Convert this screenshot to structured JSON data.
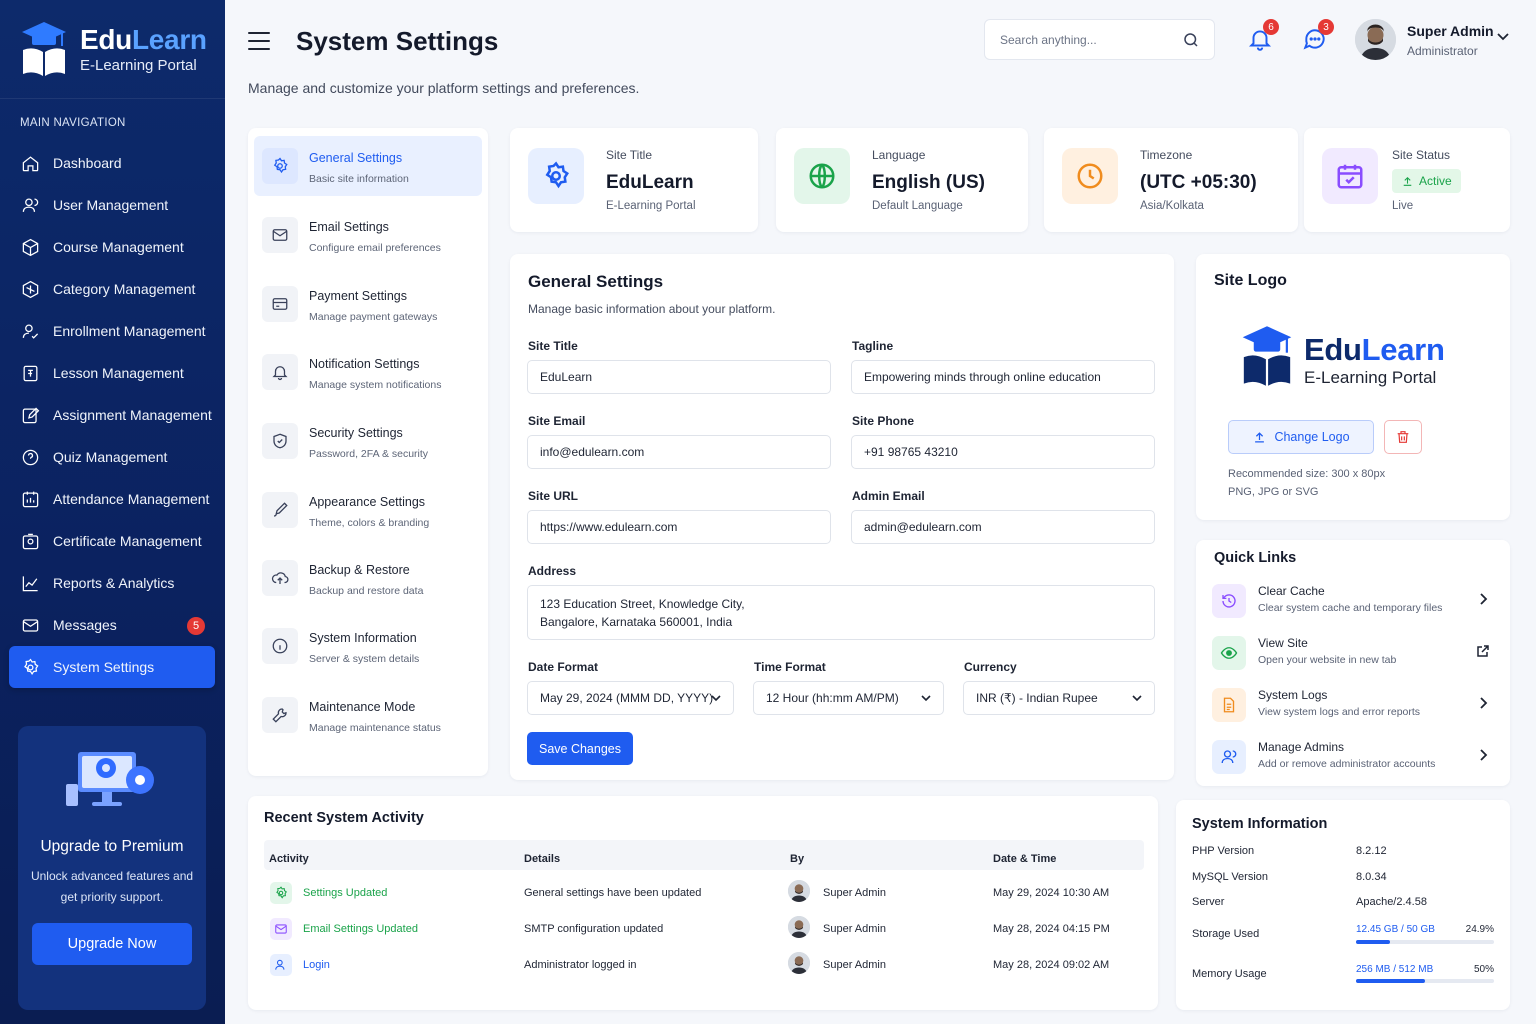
{
  "brand": {
    "name_a": "Edu",
    "name_b": "Learn",
    "subtitle": "E-Learning Portal"
  },
  "sidebar": {
    "heading": "MAIN NAVIGATION",
    "items": [
      {
        "label": "Dashboard",
        "icon": "home-icon"
      },
      {
        "label": "User Management",
        "icon": "users-icon"
      },
      {
        "label": "Course Management",
        "icon": "cube-icon"
      },
      {
        "label": "Category Management",
        "icon": "category-icon"
      },
      {
        "label": "Enrollment Management",
        "icon": "enroll-icon"
      },
      {
        "label": "Lesson Management",
        "icon": "lesson-icon"
      },
      {
        "label": "Assignment Management",
        "icon": "edit-icon"
      },
      {
        "label": "Quiz Management",
        "icon": "quiz-icon"
      },
      {
        "label": "Attendance Management",
        "icon": "attendance-icon"
      },
      {
        "label": "Certificate Management",
        "icon": "certificate-icon"
      },
      {
        "label": "Reports & Analytics",
        "icon": "chart-icon"
      },
      {
        "label": "Messages",
        "icon": "mail-icon",
        "badge": "5"
      },
      {
        "label": "System Settings",
        "icon": "gear-icon",
        "active": true
      }
    ],
    "promo": {
      "title": "Upgrade to Premium",
      "desc": "Unlock advanced features and get priority support.",
      "button": "Upgrade Now"
    }
  },
  "header": {
    "title": "System Settings",
    "subtitle": "Manage and customize your platform settings and preferences.",
    "search_placeholder": "Search anything...",
    "notif_count": "6",
    "msg_count": "3",
    "user_name": "Super Admin",
    "user_role": "Administrator"
  },
  "settings_nav": [
    {
      "title": "General Settings",
      "desc": "Basic site information",
      "active": true
    },
    {
      "title": "Email Settings",
      "desc": "Configure email preferences"
    },
    {
      "title": "Payment Settings",
      "desc": "Manage payment gateways"
    },
    {
      "title": "Notification Settings",
      "desc": "Manage system notifications"
    },
    {
      "title": "Security Settings",
      "desc": "Password, 2FA & security"
    },
    {
      "title": "Appearance Settings",
      "desc": "Theme, colors & branding"
    },
    {
      "title": "Backup & Restore",
      "desc": "Backup and restore data"
    },
    {
      "title": "System Information",
      "desc": "Server & system details"
    },
    {
      "title": "Maintenance Mode",
      "desc": "Manage maintenance status"
    }
  ],
  "stats": [
    {
      "label": "Site Title",
      "value": "EduLearn",
      "sub": "E-Learning Portal"
    },
    {
      "label": "Language",
      "value": "English (US)",
      "sub": "Default Language"
    },
    {
      "label": "Timezone",
      "value": "(UTC +05:30)",
      "sub": "Asia/Kolkata"
    },
    {
      "label": "Site Status",
      "value": "Active",
      "sub": "Live"
    }
  ],
  "general": {
    "title": "General Settings",
    "desc": "Manage basic information about your platform.",
    "site_title_label": "Site Title",
    "site_title": "EduLearn",
    "tagline_label": "Tagline",
    "tagline": "Empowering minds through online education",
    "email_label": "Site Email",
    "email": "info@edulearn.com",
    "phone_label": "Site Phone",
    "phone": "+91 98765 43210",
    "url_label": "Site URL",
    "url": "https://www.edulearn.com",
    "admin_email_label": "Admin Email",
    "admin_email": "admin@edulearn.com",
    "address_label": "Address",
    "address_line1": "123 Education Street, Knowledge City,",
    "address_line2": "Bangalore, Karnataka 560001, India",
    "date_label": "Date Format",
    "date": "May 29, 2024 (MMM DD, YYYY)",
    "time_label": "Time Format",
    "time": "12 Hour (hh:mm AM/PM)",
    "currency_label": "Currency",
    "currency": "INR (₹) - Indian Rupee",
    "save": "Save Changes"
  },
  "logo": {
    "title": "Site Logo",
    "name_a": "Edu",
    "name_b": "Learn",
    "sub": "E-Learning Portal",
    "change": "Change Logo",
    "rec1": "Recommended size: 300 x 80px",
    "rec2": "PNG, JPG or SVG"
  },
  "quick_links": {
    "title": "Quick Links",
    "items": [
      {
        "title": "Clear Cache",
        "desc": "Clear system cache and temporary files"
      },
      {
        "title": "View Site",
        "desc": "Open your website in new tab"
      },
      {
        "title": "System Logs",
        "desc": "View system logs and error reports"
      },
      {
        "title": "Manage Admins",
        "desc": "Add or remove administrator accounts"
      }
    ]
  },
  "activity": {
    "title": "Recent System Activity",
    "headers": [
      "Activity",
      "Details",
      "By",
      "Date & Time"
    ],
    "rows": [
      {
        "activity": "Settings Updated",
        "details": "General settings have been updated",
        "by": "Super Admin",
        "time": "May 29, 2024 10:30 AM"
      },
      {
        "activity": "Email Settings Updated",
        "details": "SMTP configuration updated",
        "by": "Super Admin",
        "time": "May 28, 2024 04:15 PM"
      },
      {
        "activity": "Login",
        "details": "Administrator logged in",
        "by": "Super Admin",
        "time": "May 28, 2024 09:02 AM"
      }
    ]
  },
  "system": {
    "title": "System Information",
    "php_label": "PHP Version",
    "php": "8.2.12",
    "mysql_label": "MySQL Version",
    "mysql": "8.0.34",
    "server_label": "Server",
    "server": "Apache/2.4.58",
    "storage_label": "Storage Used",
    "storage": "12.45 GB / 50 GB",
    "storage_pct": "24.9%",
    "storage_fraction": 0.249,
    "memory_label": "Memory Usage",
    "memory": "256 MB / 512 MB",
    "memory_pct": "50%",
    "memory_fraction": 0.5
  },
  "colors": {
    "primary": "#1f5cf0",
    "sidebar": "#0d2a6b",
    "success": "#1aa34a",
    "danger": "#e53935"
  }
}
